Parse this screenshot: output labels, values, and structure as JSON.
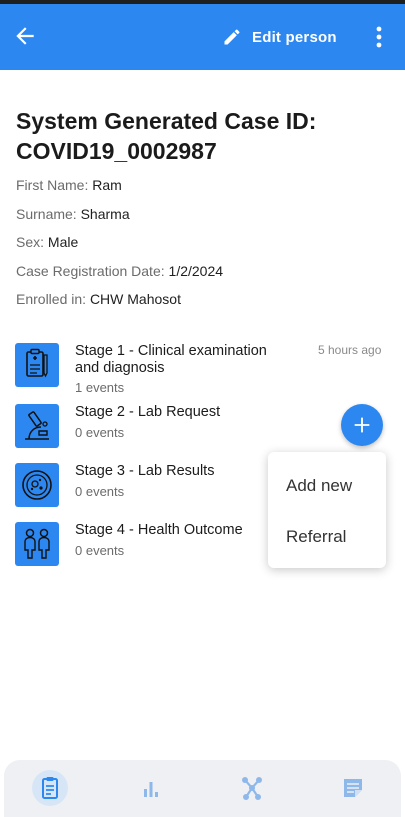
{
  "appbar": {
    "edit_label": "Edit person",
    "back_icon": "arrow-back-icon",
    "edit_icon": "pencil-icon",
    "more_icon": "more-vertical-icon",
    "color": "#2c88f0"
  },
  "case": {
    "title_line1": "System Generated Case ID:",
    "title_line2": "COVID19_0002987"
  },
  "attributes": [
    {
      "key": "First Name:",
      "value": "Ram"
    },
    {
      "key": "Surname:",
      "value": "Sharma"
    },
    {
      "key": "Sex:",
      "value": "Male"
    },
    {
      "key": "Case Registration Date:",
      "value": "1/2/2024"
    },
    {
      "key": "Enrolled in:",
      "value": "CHW Mahosot"
    }
  ],
  "stages": [
    {
      "name": "Stage 1 - Clinical examination and diagnosis",
      "count": "1 events",
      "time": "5 hours ago",
      "icon": "clipboard-medical-icon"
    },
    {
      "name": "Stage 2 - Lab Request",
      "count": "0 events",
      "icon": "microscope-icon"
    },
    {
      "name": "Stage 3 - Lab Results",
      "count": "0 events",
      "icon": "petri-dish-icon"
    },
    {
      "name": "Stage 4 - Health Outcome",
      "count": "0 events",
      "icon": "people-icon"
    }
  ],
  "fab": {
    "icon": "plus-icon"
  },
  "menu": {
    "items": [
      "Add new",
      "Referral"
    ]
  },
  "bottom_nav": {
    "items": [
      "dashboard-icon",
      "analytics-icon",
      "relationships-icon",
      "notes-icon"
    ],
    "active": "dashboard-icon"
  }
}
